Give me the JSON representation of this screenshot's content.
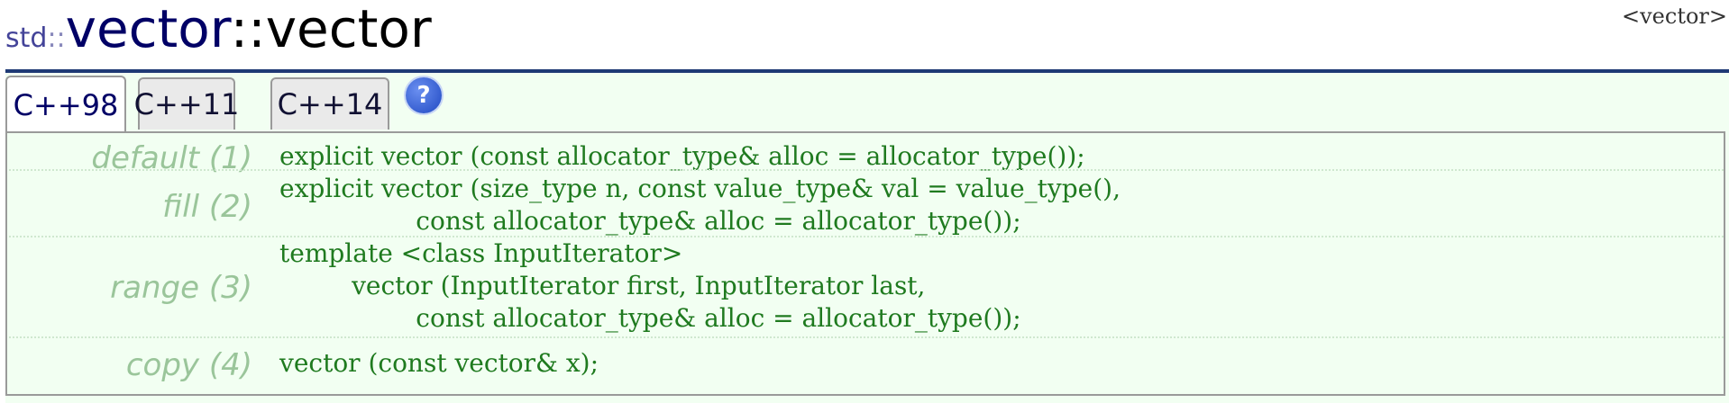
{
  "title": {
    "namespace": "std",
    "sep": "::",
    "class_name": "vector",
    "member": "vector"
  },
  "header_link": "<vector>",
  "tabs": [
    {
      "label": "C++98",
      "active": true
    },
    {
      "label": "C++11",
      "active": false
    },
    {
      "label": "C++14",
      "active": false
    }
  ],
  "help_icon": "question-circle-icon",
  "help_glyph": "?",
  "declarations": [
    {
      "label": "default (1)",
      "code": "explicit vector (const allocator_type& alloc = allocator_type());"
    },
    {
      "label": "fill (2)",
      "code": "explicit vector (size_type n, const value_type& val = value_type(),\n                 const allocator_type& alloc = allocator_type());"
    },
    {
      "label": "range (3)",
      "code": "template <class InputIterator>\n         vector (InputIterator first, InputIterator last,\n                 const allocator_type& alloc = allocator_type());"
    },
    {
      "label": "copy (4)",
      "code": "vector (const vector& x);"
    }
  ],
  "colors": {
    "title_class": "#000066",
    "rule": "#1f3a75",
    "panel_bg": "#f2fff2",
    "code": "#1f7a1f",
    "label": "#9ac59a"
  }
}
